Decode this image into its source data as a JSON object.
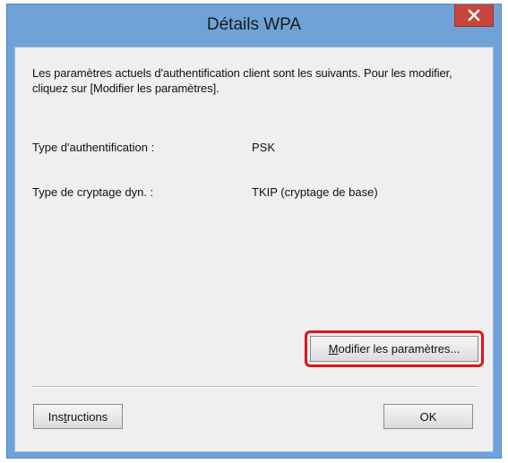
{
  "window": {
    "title": "Détails WPA"
  },
  "content": {
    "description": "Les paramètres actuels d'authentification client sont les suivants. Pour les modifier, cliquez sur [Modifier les paramètres].",
    "auth_type_label": "Type d'authentification :",
    "auth_type_value": "PSK",
    "encryption_label": "Type de cryptage dyn. :",
    "encryption_value": "TKIP (cryptage de base)"
  },
  "buttons": {
    "modify_label_mnemonic": "M",
    "modify_label_rest": "odifier les paramètres...",
    "instructions_label_pre": "Ins",
    "instructions_label_mnemonic": "t",
    "instructions_label_post": "ructions",
    "ok_label": "OK"
  },
  "icons": {
    "close": "close-icon"
  },
  "colors": {
    "titlebar": "#6fa3d8",
    "close_button": "#c7453a",
    "highlight": "#e0141b",
    "client_background": "#efefef"
  }
}
